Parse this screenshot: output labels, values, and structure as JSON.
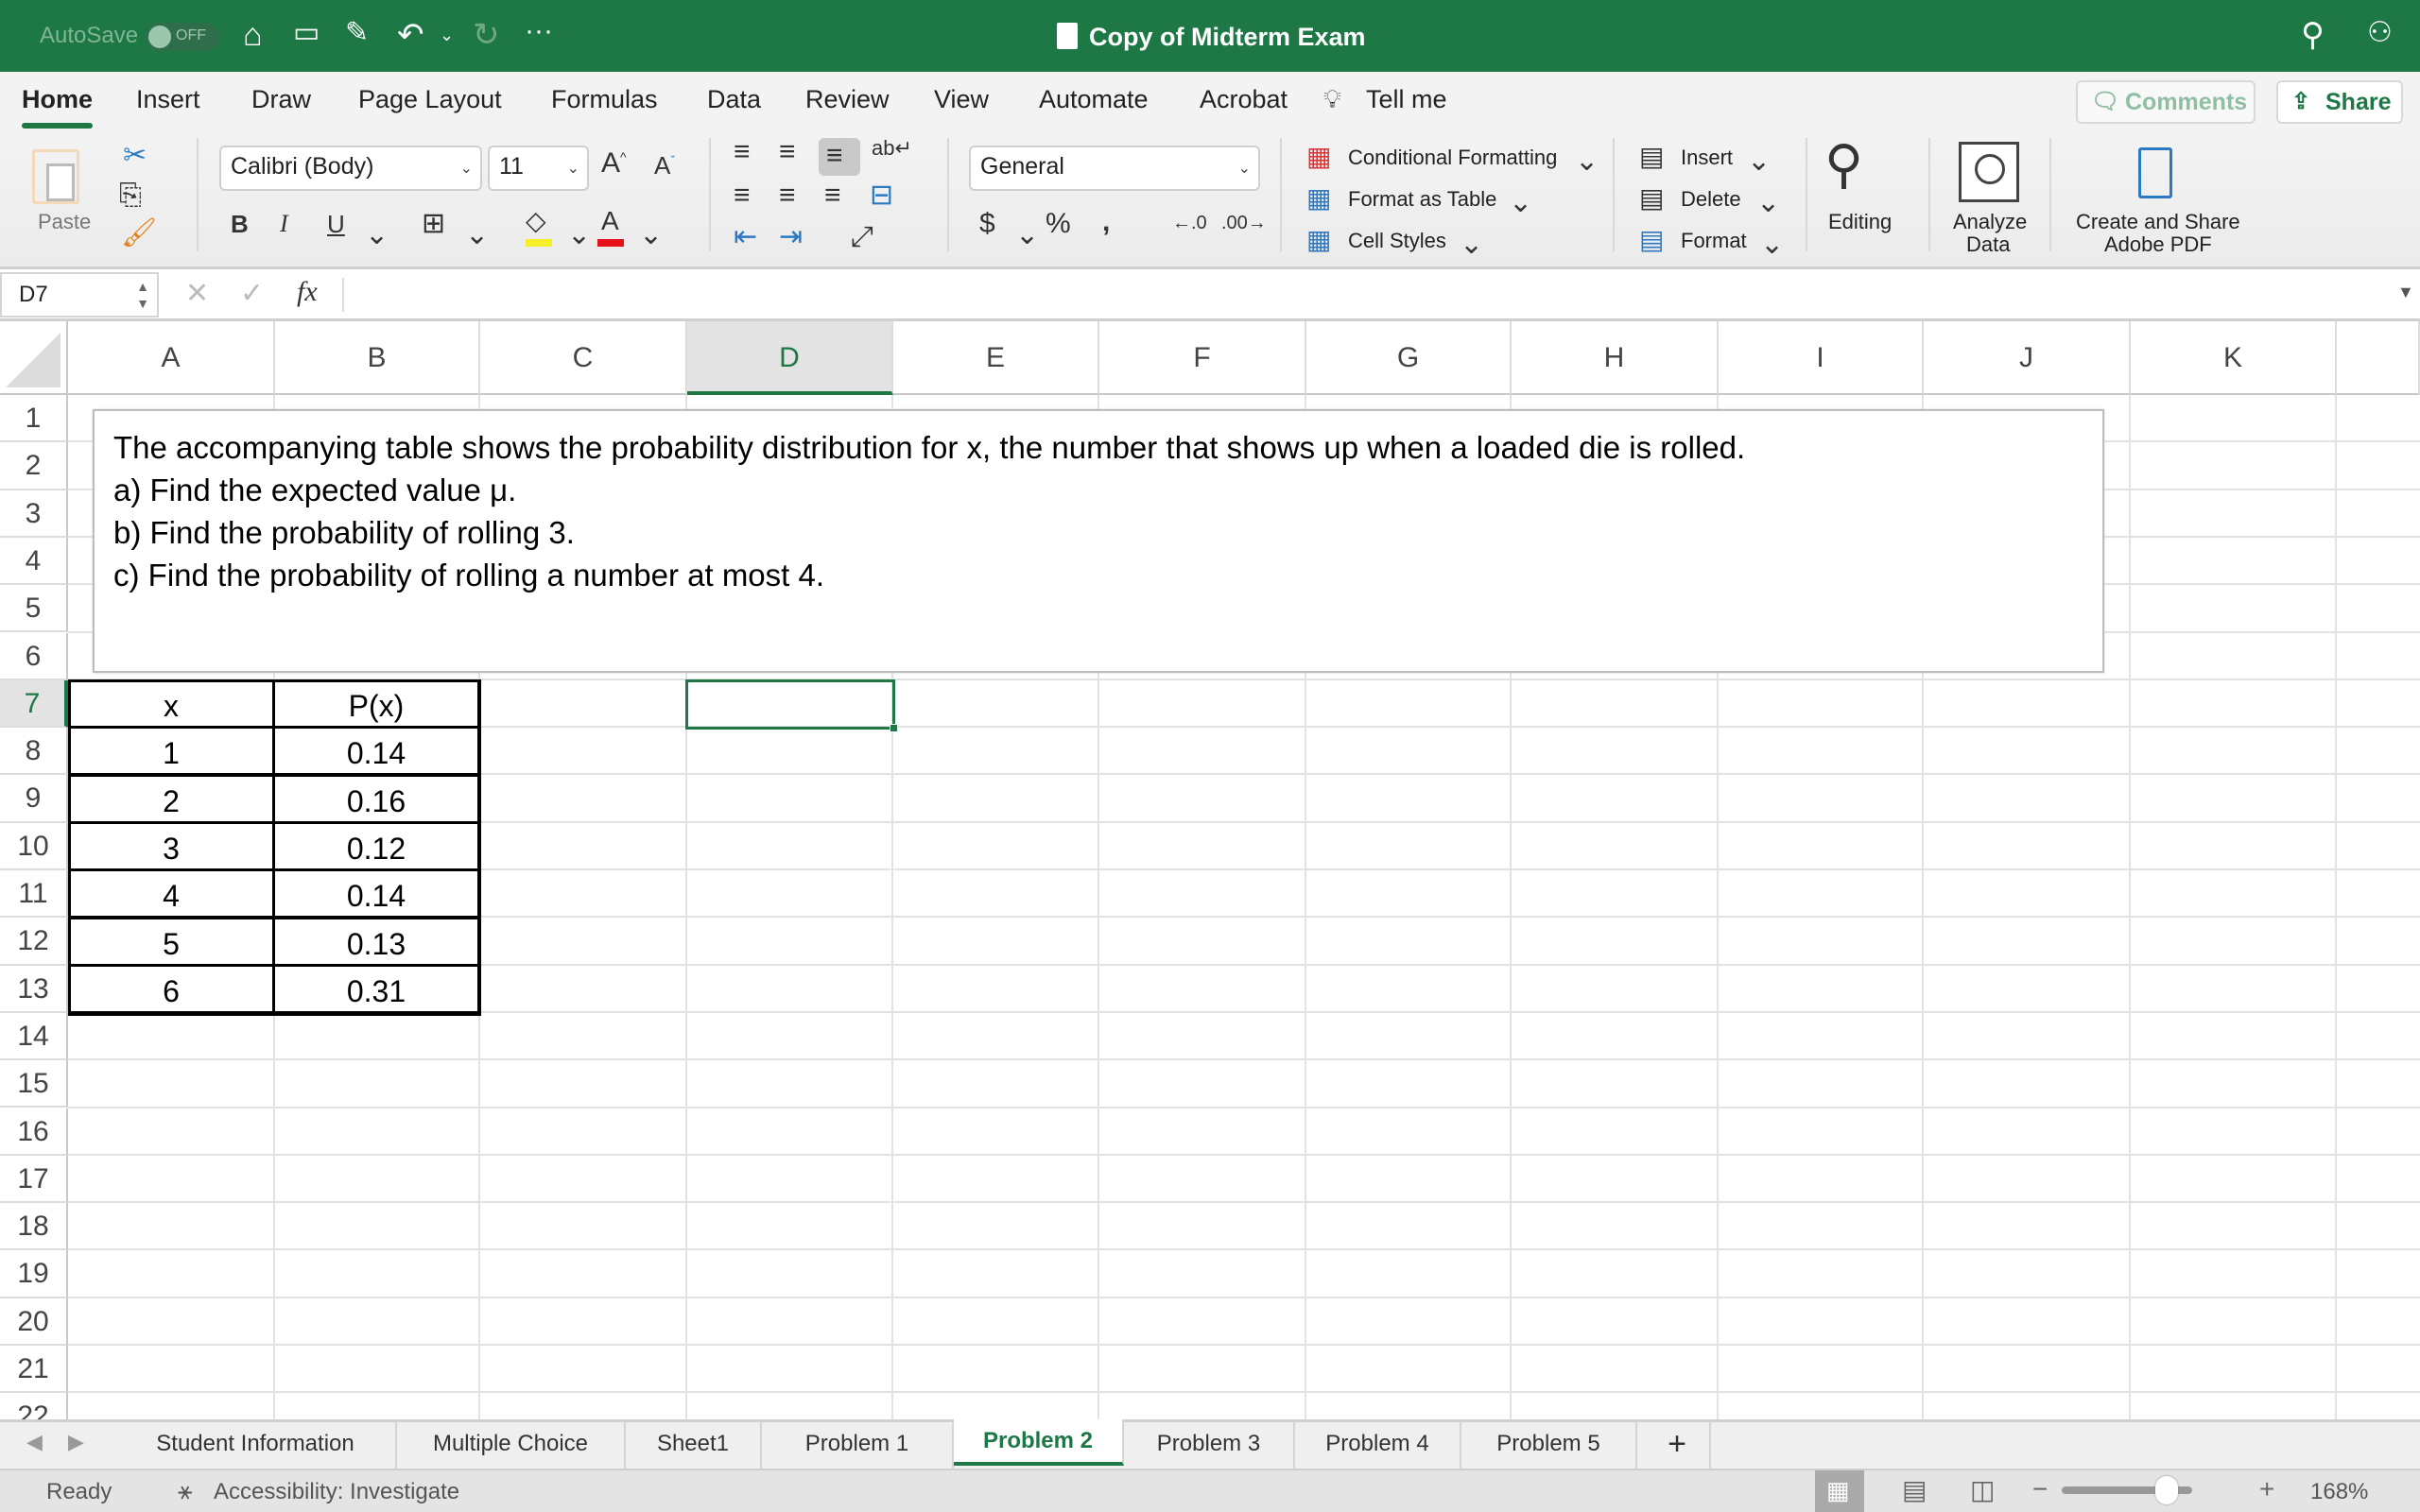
{
  "titlebar": {
    "autosave_label": "AutoSave",
    "autosave_state": "OFF",
    "title": "Copy of Midterm Exam"
  },
  "tabs": [
    "Home",
    "Insert",
    "Draw",
    "Page Layout",
    "Formulas",
    "Data",
    "Review",
    "View",
    "Automate",
    "Acrobat"
  ],
  "active_tab": "Home",
  "tell_me": "Tell me",
  "comments_label": "Comments",
  "share_label": "Share",
  "ribbon": {
    "paste": "Paste",
    "font_name": "Calibri (Body)",
    "font_size": "11",
    "bold": "B",
    "italic": "I",
    "underline": "U",
    "number_format": "General",
    "conditional_formatting": "Conditional Formatting",
    "format_as_table": "Format as Table",
    "cell_styles": "Cell Styles",
    "insert": "Insert",
    "delete": "Delete",
    "format": "Format",
    "editing": "Editing",
    "analyze_data_1": "Analyze",
    "analyze_data_2": "Data",
    "create_share_1": "Create and Share",
    "create_share_2": "Adobe PDF",
    "colors": {
      "highlight": "#f5ef2a",
      "font_color": "#e8101a",
      "accent": "#1d7845"
    }
  },
  "formula_bar": {
    "name_box": "D7",
    "fx": "fx",
    "value": ""
  },
  "columns": [
    "A",
    "B",
    "C",
    "D",
    "E",
    "F",
    "G",
    "H",
    "I",
    "J",
    "K"
  ],
  "selected_column": "D",
  "rows": [
    "1",
    "2",
    "3",
    "4",
    "5",
    "6",
    "7",
    "8",
    "9",
    "10",
    "11",
    "12",
    "13",
    "14",
    "15",
    "16",
    "17",
    "18",
    "19",
    "20",
    "21",
    "22"
  ],
  "selected_row": "7",
  "textbox": {
    "lines": [
      "The accompanying table shows the probability distribution for x, the number that shows up when a loaded die is rolled.",
      "a) Find the expected value μ.",
      "b) Find the probability of rolling 3.",
      "c) Find the probability of rolling a number at most 4."
    ]
  },
  "table": {
    "headers": [
      "x",
      "P(x)"
    ],
    "rows": [
      [
        "1",
        "0.14"
      ],
      [
        "2",
        "0.16"
      ],
      [
        "3",
        "0.12"
      ],
      [
        "4",
        "0.14"
      ],
      [
        "5",
        "0.13"
      ],
      [
        "6",
        "0.31"
      ]
    ]
  },
  "sheets": [
    "Student Information",
    "Multiple Choice",
    "Sheet1",
    "Problem 1",
    "Problem 2",
    "Problem 3",
    "Problem 4",
    "Problem 5"
  ],
  "active_sheet": "Problem 2",
  "add_sheet": "+",
  "status": {
    "ready": "Ready",
    "accessibility": "Accessibility: Investigate",
    "zoom": "168%",
    "zoom_level_percent": 168
  }
}
